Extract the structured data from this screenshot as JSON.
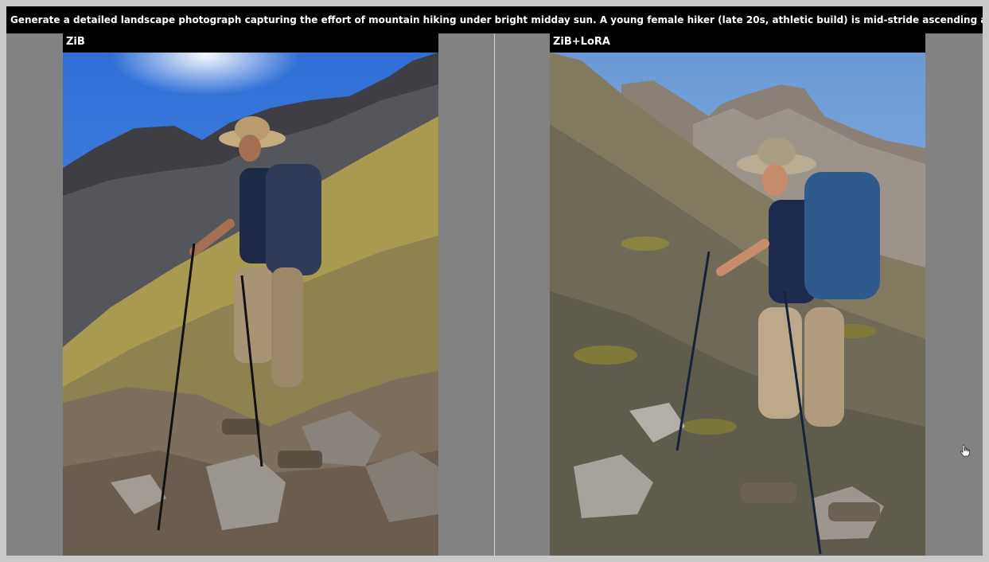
{
  "prompt": "Generate a detailed landscape photograph capturing the effort of mountain hiking under bright midday sun. A young female hiker (late 20s, athletic build) is mid-stride ascending a steep, rocky section of trail...",
  "panels": [
    {
      "label": "ZiB"
    },
    {
      "label": "ZiB+LoRA"
    }
  ],
  "colors": {
    "frame": "#828282",
    "bar": "#000000"
  },
  "icons": {
    "cursor": "hand-cursor-icon"
  }
}
